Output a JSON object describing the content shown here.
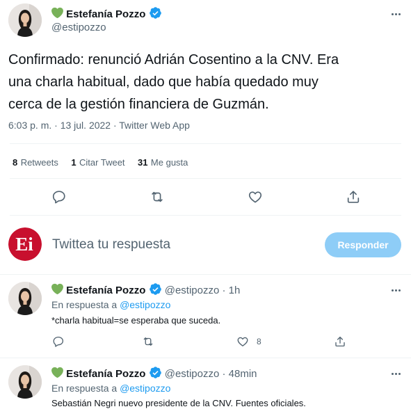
{
  "main_tweet": {
    "author_name": "Estefanía Pozzo",
    "handle": "@estipozzo",
    "text_lines": [
      "Confirmado: renunció Adrián Cosentino a la CNV. Era",
      "una charla habitual, dado que había quedado muy",
      "cerca de la gestión financiera de Guzmán."
    ],
    "meta": "6:03 p. m. · 13 jul. 2022 · Twitter Web App"
  },
  "stats": {
    "retweets_count": "8",
    "retweets_label": "Retweets",
    "quotes_count": "1",
    "quotes_label": "Citar Tweet",
    "likes_count": "31",
    "likes_label": "Me gusta"
  },
  "composer": {
    "avatar_text": "Ei",
    "placeholder": "Twittea tu respuesta",
    "button_label": "Responder"
  },
  "replies": [
    {
      "author_name": "Estefanía Pozzo",
      "handle": "@estipozzo",
      "time": "· 1h",
      "reply_prefix": "En respuesta a",
      "reply_to": "@estipozzo",
      "text": "*charla habitual=se esperaba que suceda.",
      "like_count": "8"
    },
    {
      "author_name": "Estefanía Pozzo",
      "handle": "@estipozzo",
      "time": "· 48min",
      "reply_prefix": "En respuesta a",
      "reply_to": "@estipozzo",
      "text": "Sebastián Negri nuevo presidente de la CNV. Fuentes oficiales."
    }
  ],
  "colors": {
    "accent": "#1d9bf0",
    "heart_emoji": "#78b159",
    "button_disabled": "#8ecdf7",
    "composer_logo": "#c8102e"
  },
  "icons": [
    "green-heart-icon",
    "verified-badge-icon",
    "more-icon",
    "reply-icon",
    "retweet-icon",
    "like-icon",
    "share-icon"
  ]
}
